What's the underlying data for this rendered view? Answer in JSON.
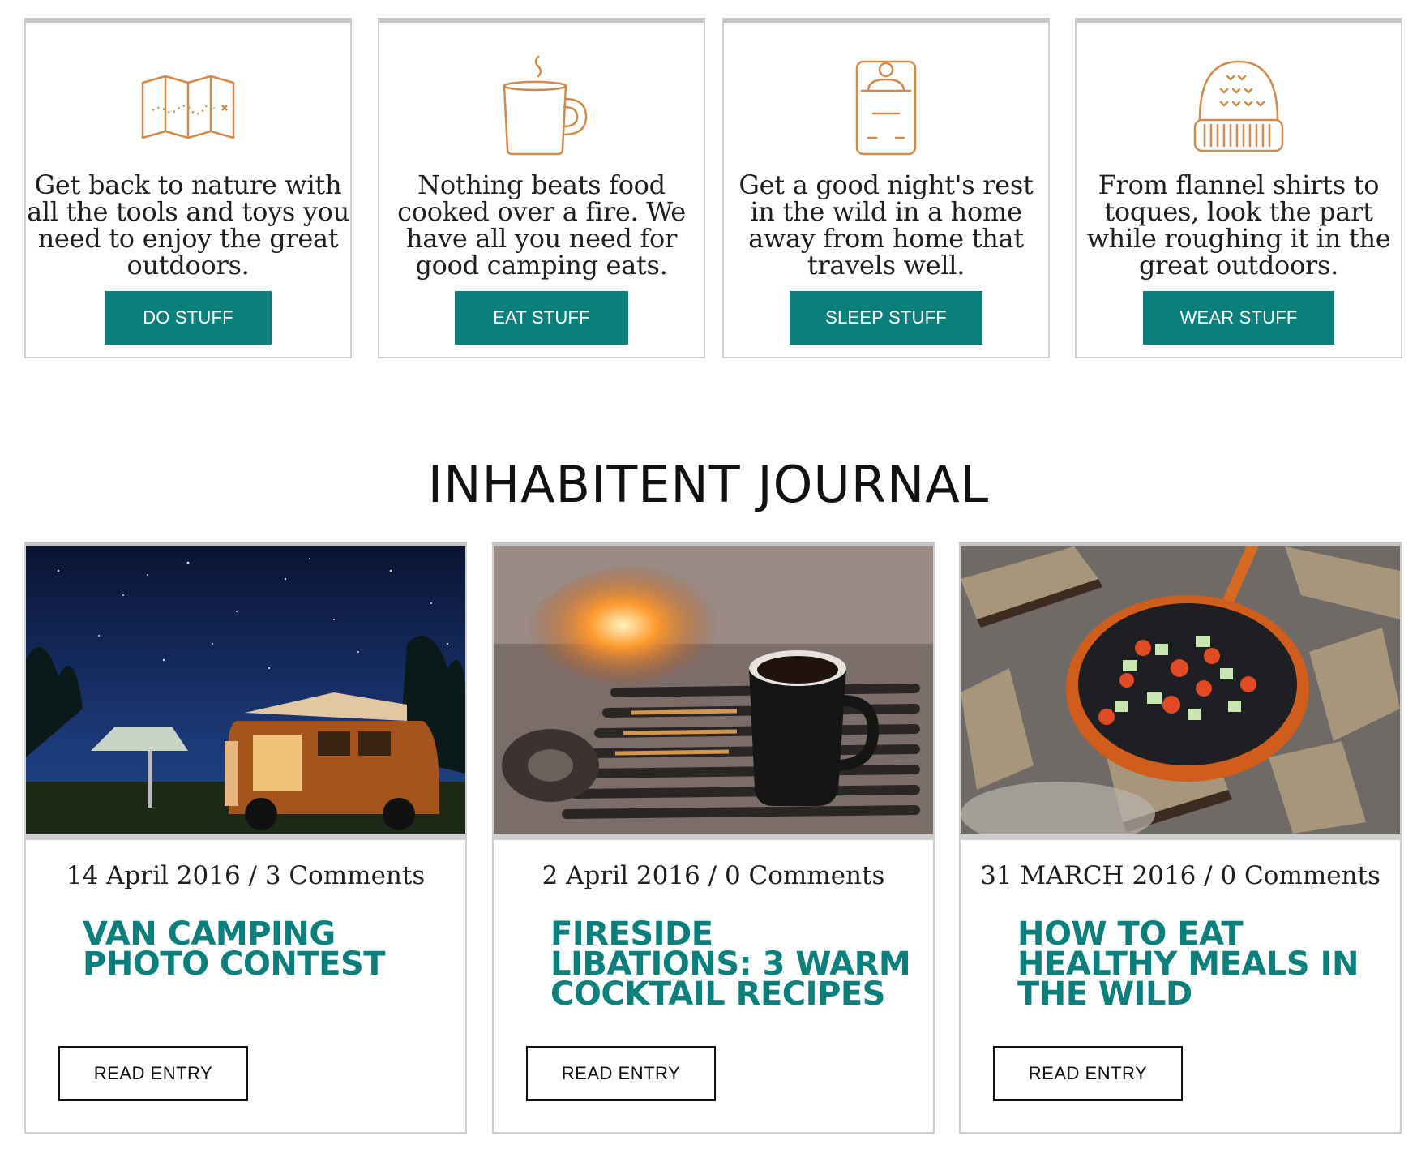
{
  "colors": {
    "accent": "#0b7f7b",
    "icon_stroke": "#d18a4a",
    "card_border": "#cfcfcf"
  },
  "categories": [
    {
      "icon": "map-icon",
      "text": "Get back to nature with all the tools and toys you need to enjoy the great outdoors.",
      "button": "DO STUFF"
    },
    {
      "icon": "mug-icon",
      "text": "Nothing beats food cooked over a fire. We have all you need for good camping eats.",
      "button": "EAT STUFF"
    },
    {
      "icon": "sleeping-bag-icon",
      "text": "Get a good night's rest in the wild in a home away from home that travels well.",
      "button": "SLEEP STUFF"
    },
    {
      "icon": "toque-icon",
      "text": "From flannel shirts to toques, look the part while roughing it in the great outdoors.",
      "button": "WEAR STUFF"
    }
  ],
  "journal": {
    "title": "INHABITENT JOURNAL",
    "posts": [
      {
        "image": "van-under-stars-photo",
        "meta": "14 April 2016 / 3 Comments",
        "title": "VAN CAMPING PHOTO CONTEST",
        "button": "READ ENTRY"
      },
      {
        "image": "coffee-cup-on-fire-grill-photo",
        "meta": "2 April 2016 / 0 Comments",
        "title": "FIRESIDE LIBATIONS: 3 WARM COCKTAIL RECIPES",
        "button": "READ ENTRY"
      },
      {
        "image": "skillet-over-campfire-photo",
        "meta": "31 MARCH 2016 / 0 Comments",
        "title": "HOW TO EAT HEALTHY MEALS IN THE WILD",
        "button": "READ ENTRY"
      }
    ]
  }
}
